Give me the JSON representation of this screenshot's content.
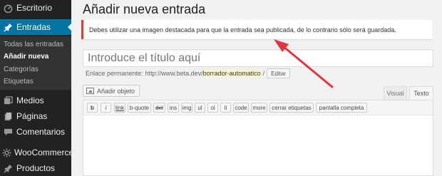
{
  "sidebar": {
    "items": [
      {
        "label": "Escritorio",
        "icon": "dashboard-icon"
      },
      {
        "label": "Entradas",
        "icon": "pin-icon",
        "active": true
      },
      {
        "label": "Medios",
        "icon": "media-icon"
      },
      {
        "label": "Páginas",
        "icon": "pages-icon"
      },
      {
        "label": "Comentarios",
        "icon": "comments-icon"
      },
      {
        "label": "WooCommerce",
        "icon": "woocommerce-icon"
      },
      {
        "label": "Productos",
        "icon": "pin-icon"
      }
    ],
    "submenu": [
      "Todas las entradas",
      "Añadir nueva",
      "Categorías",
      "Etiquetas"
    ],
    "colors": {
      "background": "#222222",
      "active": "#0074a2",
      "submenu": "#333333"
    }
  },
  "main": {
    "title": "Añadir nueva entrada",
    "notice": "Debes utilizar una imagen destacada para que la entrada sea publicada, de lo contrario sólo será guardada.",
    "notice_color": "#dd3d36",
    "title_placeholder": "Introduce el título aquí",
    "permalink": {
      "label": "Enlace permanente:",
      "url": "http://www.beta.dev/",
      "slug": "borrador-automatico",
      "suffix": "/",
      "edit_button": "Editar"
    },
    "add_media": "Añadir objeto",
    "tabs": {
      "visual": "Visual",
      "text": "Texto"
    },
    "quicktags": [
      "b",
      "i",
      "link",
      "b-quote",
      "del",
      "ins",
      "img",
      "ul",
      "ol",
      "li",
      "code",
      "more",
      "cerrar etiquetas",
      "pantalla completa"
    ]
  },
  "annotation": {
    "arrow_color": "#e0343f"
  }
}
